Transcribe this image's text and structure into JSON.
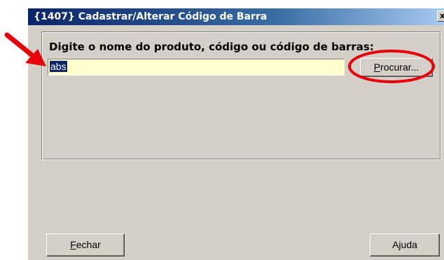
{
  "window": {
    "title": "{1407} Cadastrar/Alterar Código de Barra",
    "close_label": "x"
  },
  "form": {
    "prompt": "Digite o nome do produto, código ou código de barras:",
    "search_value": "abs",
    "search_button": {
      "mnemonic": "P",
      "rest": "rocurar..."
    }
  },
  "footer": {
    "close_button": {
      "mnemonic": "F",
      "rest": "echar"
    },
    "help_button": "Ajuda"
  },
  "colors": {
    "input_background": "#ffffcc",
    "annotation": "#e8000b",
    "dialog_background": "#d4d0c8"
  },
  "annotations": {
    "arrow_icon": "red-arrow-icon",
    "ellipse_icon": "red-ellipse-highlight"
  }
}
